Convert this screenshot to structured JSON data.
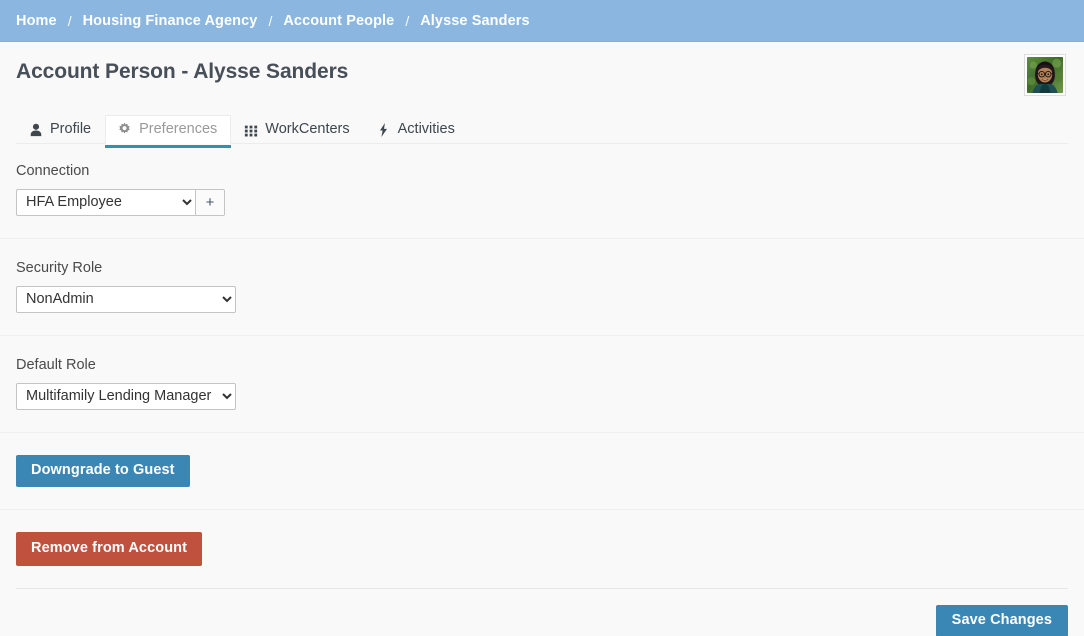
{
  "breadcrumb": {
    "separator": "/",
    "items": [
      {
        "label": "Home"
      },
      {
        "label": "Housing Finance Agency"
      },
      {
        "label": "Account People"
      },
      {
        "label": "Alysse Sanders"
      }
    ]
  },
  "header": {
    "title": "Account Person - Alysse Sanders",
    "avatar_alt": "Alysse Sanders"
  },
  "tabs": [
    {
      "label": "Profile",
      "icon": "user-icon",
      "active": false
    },
    {
      "label": "Preferences",
      "icon": "gear-icon",
      "active": true
    },
    {
      "label": "WorkCenters",
      "icon": "grid-icon",
      "active": false
    },
    {
      "label": "Activities",
      "icon": "lightning-icon",
      "active": false
    }
  ],
  "form": {
    "connection": {
      "label": "Connection",
      "value": "HFA Employee",
      "options": [
        "HFA Employee"
      ],
      "add_button_label": "+"
    },
    "security_role": {
      "label": "Security Role",
      "value": "NonAdmin",
      "options": [
        "NonAdmin"
      ]
    },
    "default_role": {
      "label": "Default Role",
      "value": "Multifamily Lending Manager",
      "options": [
        "Multifamily Lending Manager"
      ]
    }
  },
  "actions": {
    "downgrade_label": "Downgrade to Guest",
    "remove_label": "Remove from Account",
    "save_label": "Save Changes"
  },
  "colors": {
    "breadcrumb_bg": "#8ab6e0",
    "page_bg": "#f9f9f9",
    "accent_tab_underline": "#2e92b2",
    "primary_button": "#3a87b6",
    "danger_button": "#c1513f",
    "title_text": "#474f58"
  }
}
